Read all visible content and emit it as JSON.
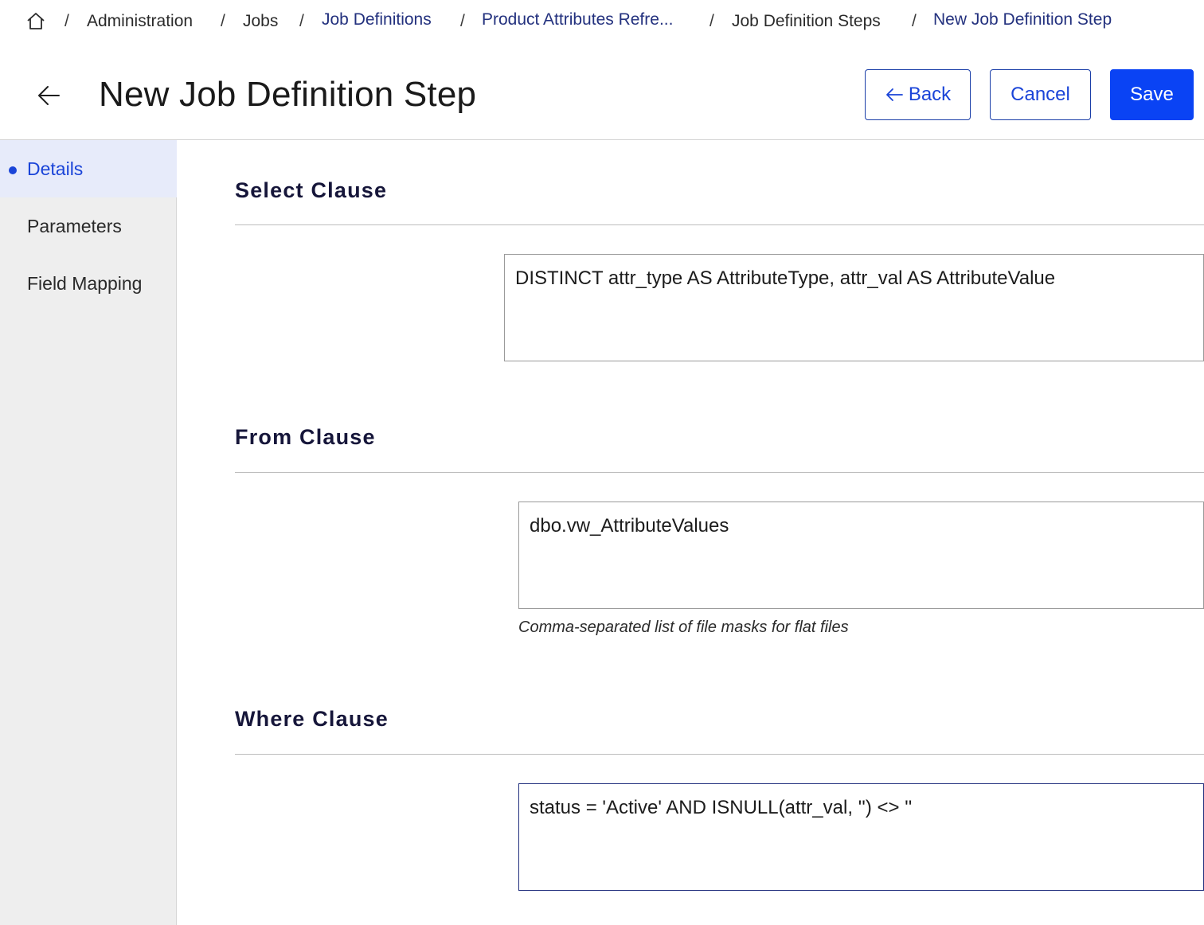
{
  "breadcrumb": {
    "home_icon": "home-icon",
    "items": [
      "Administration",
      "Jobs",
      "Job Definitions",
      "Product Attributes Refre...",
      "Job Definition Steps",
      "New Job Definition Step"
    ],
    "separator": "/"
  },
  "header": {
    "back_icon": "arrow-left-icon",
    "title": "New Job Definition Step",
    "back_label": "Back",
    "cancel_label": "Cancel",
    "save_label": "Save"
  },
  "sidebar": {
    "items": [
      {
        "label": "Details",
        "active": true
      },
      {
        "label": "Parameters",
        "active": false
      },
      {
        "label": "Field Mapping",
        "active": false
      }
    ]
  },
  "sections": {
    "select": {
      "title": "Select Clause",
      "value": "DISTINCT attr_type AS AttributeType, attr_val AS AttributeValue"
    },
    "from": {
      "title": "From Clause",
      "value": "dbo.vw_AttributeValues",
      "helper": "Comma-separated list of file masks for flat files"
    },
    "where": {
      "title": "Where Clause",
      "value": "status = 'Active' AND ISNULL(attr_val, '') <> ''"
    }
  },
  "colors": {
    "primary": "#0a43f4",
    "link": "#23317e",
    "sidebar_bg": "#eeeeee",
    "sidebar_active_bg": "#e7ebfa"
  }
}
